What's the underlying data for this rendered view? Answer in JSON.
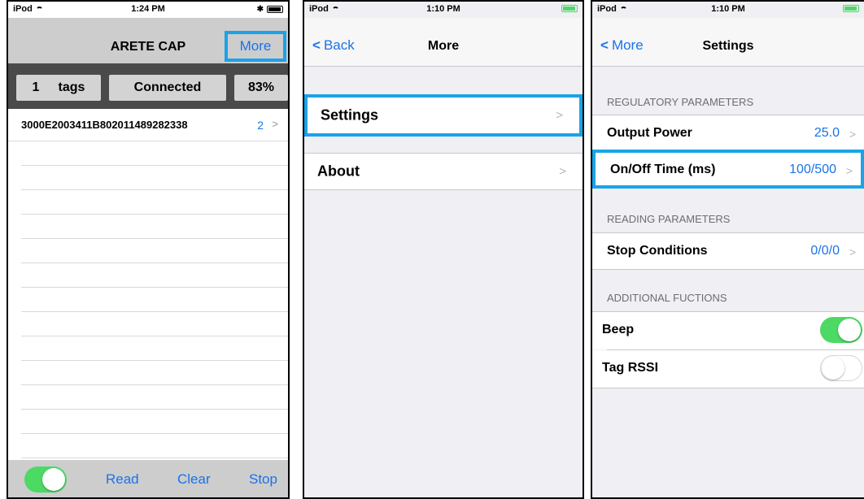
{
  "screen1": {
    "status": {
      "carrier": "iPod",
      "time": "1:24 PM"
    },
    "nav": {
      "title": "ARETE CAP",
      "more": "More"
    },
    "summary": {
      "tag_count": "1",
      "tags_label": "tags",
      "connection": "Connected",
      "percent": "83%"
    },
    "tags": [
      {
        "epc": "3000E2003411B802011489282338",
        "count": "2"
      }
    ],
    "toolbar": {
      "read": "Read",
      "clear": "Clear",
      "stop": "Stop",
      "toggle_on": true
    }
  },
  "screen2": {
    "status": {
      "carrier": "iPod",
      "time": "1:10 PM"
    },
    "nav": {
      "back": "Back",
      "title": "More"
    },
    "items": [
      {
        "label": "Settings"
      },
      {
        "label": "About"
      }
    ]
  },
  "screen3": {
    "status": {
      "carrier": "iPod",
      "time": "1:10 PM"
    },
    "nav": {
      "back": "More",
      "title": "Settings"
    },
    "sections": {
      "regulatory": "REGULATORY PARAMETERS",
      "reading": "READING PARAMETERS",
      "additional": "ADDITIONAL FUCTIONS"
    },
    "rows": {
      "output_power": {
        "label": "Output Power",
        "value": "25.0"
      },
      "on_off_time": {
        "label": "On/Off Time (ms)",
        "value": "100/500"
      },
      "stop_conditions": {
        "label": "Stop Conditions",
        "value": "0/0/0"
      },
      "beep": {
        "label": "Beep",
        "on": true
      },
      "tag_rssi": {
        "label": "Tag RSSI",
        "on": false
      }
    }
  },
  "colors": {
    "accent": "#1a73e8",
    "highlight": "#1aa3e8",
    "toggle_on": "#4cd964"
  }
}
